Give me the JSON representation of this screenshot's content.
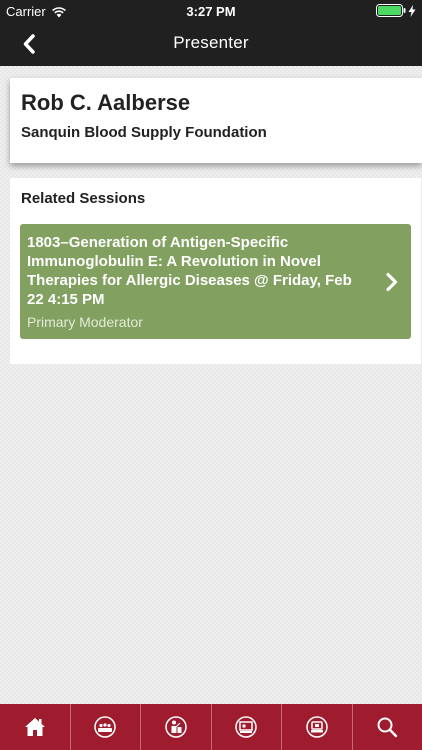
{
  "status_bar": {
    "carrier": "Carrier",
    "time": "3:27 PM"
  },
  "nav": {
    "title": "Presenter"
  },
  "presenter": {
    "name": "Rob C. Aalberse",
    "organization": "Sanquin Blood Supply Foundation"
  },
  "related_sessions": {
    "heading": "Related Sessions",
    "items": [
      {
        "title": "1803–Generation of Antigen-Specific Immunoglobulin E: A Revolution in Novel Therapies for Allergic Diseases @ Friday, Feb 22 4:15 PM",
        "role": "Primary Moderator"
      }
    ]
  },
  "tab_bar": {
    "tabs": [
      {
        "icon": "home-icon"
      },
      {
        "icon": "meeting-icon"
      },
      {
        "icon": "presenter-icon"
      },
      {
        "icon": "exhibit-icon"
      },
      {
        "icon": "schedule-icon"
      },
      {
        "icon": "search-icon"
      }
    ]
  },
  "colors": {
    "top_bar": "#202020",
    "tab_bar": "#9e1c2e",
    "session_green": "#82a060",
    "battery_green": "#4cd964"
  }
}
